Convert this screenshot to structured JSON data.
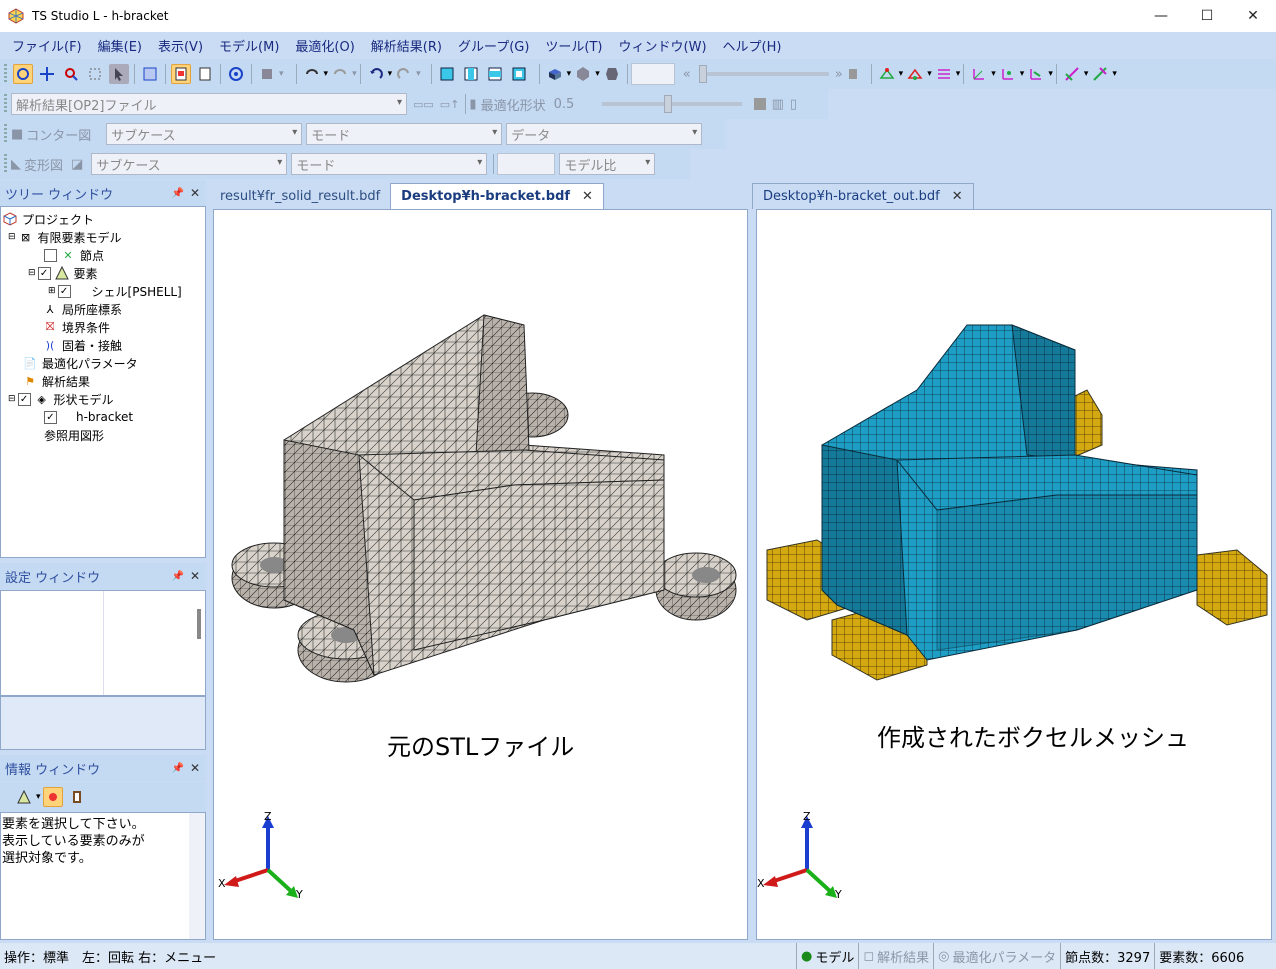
{
  "window": {
    "title": "TS Studio L - h-bracket"
  },
  "menu": [
    "ファイル(F)",
    "編集(E)",
    "表示(V)",
    "モデル(M)",
    "最適化(O)",
    "解析結果(R)",
    "グループ(G)",
    "ツール(T)",
    "ウィンドウ(W)",
    "ヘルプ(H)"
  ],
  "toolbar2": {
    "file_dropdown": "解析結果[OP2]ファイル",
    "opt_shape_label": "最適化形状",
    "opt_value": "0.5"
  },
  "toolbar3": {
    "contour_label": "コンター図",
    "subcase": "サブケース",
    "mode": "モード",
    "data": "データ"
  },
  "toolbar4": {
    "deform_label": "変形図",
    "subcase": "サブケース",
    "mode": "モード",
    "model_ratio": "モデル比"
  },
  "tree_panel": {
    "title": "ツリー ウィンドウ",
    "items": [
      "プロジェクト",
      "有限要素モデル",
      "節点",
      "要素",
      "シェル[PSHELL]",
      "局所座標系",
      "境界条件",
      "固着・接触",
      "最適化パラメータ",
      "解析結果",
      "形状モデル",
      "h-bracket",
      "参照用図形"
    ]
  },
  "settings_panel": {
    "title": "設定 ウィンドウ"
  },
  "info_panel": {
    "title": "情報 ウィンドウ",
    "lines": [
      "要素を選択して下さい。",
      "表示している要素のみが",
      "選択対象です。"
    ]
  },
  "left_view": {
    "tabs": [
      "result¥fr_solid_result.bdf",
      "Desktop¥h-bracket.bdf"
    ],
    "active_tab": 1,
    "caption": "元のSTLファイル"
  },
  "right_view": {
    "tabs": [
      "Desktop¥h-bracket_out.bdf"
    ],
    "caption": "作成されたボクセルメッシュ"
  },
  "axes": {
    "x": "X",
    "y": "Y",
    "z": "Z"
  },
  "status": {
    "operation": "操作：標準　左：回転 右：メニュー",
    "model": "モデル",
    "results": "解析結果",
    "opt_params": "最適化パラメータ",
    "nodes": "節点数：3297",
    "elements": "要素数：6606"
  },
  "colors": {
    "voxel_main": "#1e9ec4",
    "voxel_fixed": "#d4a810",
    "stl_mesh": "#d8d2ca",
    "accent": "#1b3d80"
  }
}
